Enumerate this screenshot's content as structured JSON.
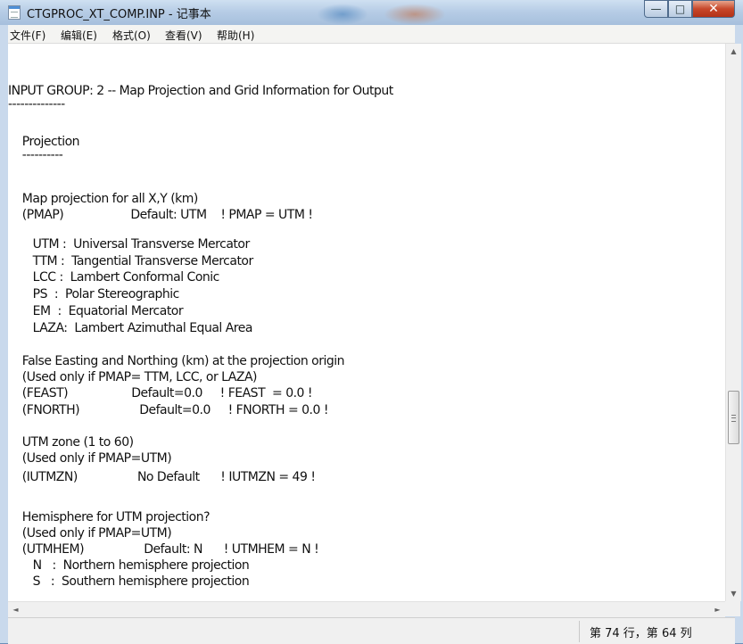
{
  "window": {
    "title": "CTGPROC_XT_COMP.INP - 记事本",
    "controls": {
      "minimize": "—",
      "maximize": "□",
      "close": "✕"
    }
  },
  "menu": [
    "文件(F)",
    "编辑(E)",
    "格式(O)",
    "查看(V)",
    "帮助(H)"
  ],
  "lines": [
    "INPUT GROUP: 2 -- Map Projection and Grid Information for Output",
    "--------------",
    "",
    "    Projection",
    "    ----------",
    "",
    "    Map projection for all X,Y (km)",
    "    (PMAP)                   Default: UTM    ! PMAP = UTM !",
    "",
    "       UTM :  Universal Transverse Mercator",
    "       TTM :  Tangential Transverse Mercator",
    "       LCC :  Lambert Conformal Conic",
    "       PS  :  Polar Stereographic",
    "       EM  :  Equatorial Mercator",
    "       LAZA:  Lambert Azimuthal Equal Area",
    "",
    "    False Easting and Northing (km) at the projection origin",
    "    (Used only if PMAP= TTM, LCC, or LAZA)",
    "    (FEAST)                  Default=0.0     ! FEAST  = 0.0 !",
    "    (FNORTH)                 Default=0.0     ! FNORTH = 0.0 !",
    "",
    "    UTM zone (1 to 60)",
    "    (Used only if PMAP=UTM)",
    "    (IUTMZN)                 No Default      ! IUTMZN = 49 !",
    "",
    "    Hemisphere for UTM projection?",
    "    (Used only if PMAP=UTM)",
    "    (UTMHEM)                 Default: N      ! UTMHEM = N !",
    "       N   :  Northern hemisphere projection",
    "       S   :  Southern hemisphere projection"
  ],
  "scroll": {
    "up": "▲",
    "down": "▼",
    "left": "◄",
    "right": "►",
    "vertical_position": 0.62
  },
  "status": {
    "position": "第 74 行，第 64 列"
  }
}
